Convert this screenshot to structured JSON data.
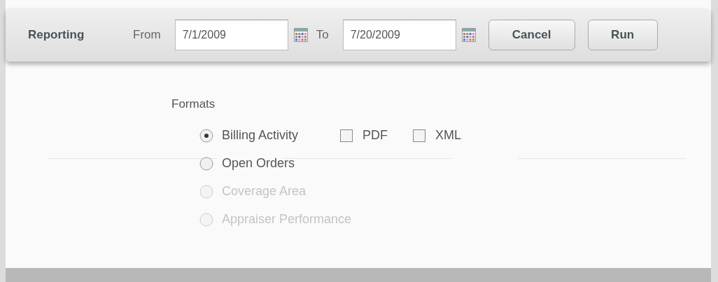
{
  "toolbar": {
    "title": "Reporting",
    "from_label": "From",
    "from_value": "7/1/2009",
    "to_label": "To",
    "to_value": "7/20/2009",
    "buttons": [
      "Cancel",
      "Run"
    ]
  },
  "formats": {
    "title": "Formats",
    "reports": [
      {
        "label": "Billing Activity",
        "selected": true,
        "disabled": false
      },
      {
        "label": "Open Orders",
        "selected": false,
        "disabled": false
      },
      {
        "label": "Coverage Area",
        "selected": false,
        "disabled": true
      },
      {
        "label": "Appraiser Performance",
        "selected": false,
        "disabled": true
      }
    ],
    "outputs": [
      {
        "label": "PDF",
        "checked": false
      },
      {
        "label": "XML",
        "checked": false
      }
    ]
  }
}
